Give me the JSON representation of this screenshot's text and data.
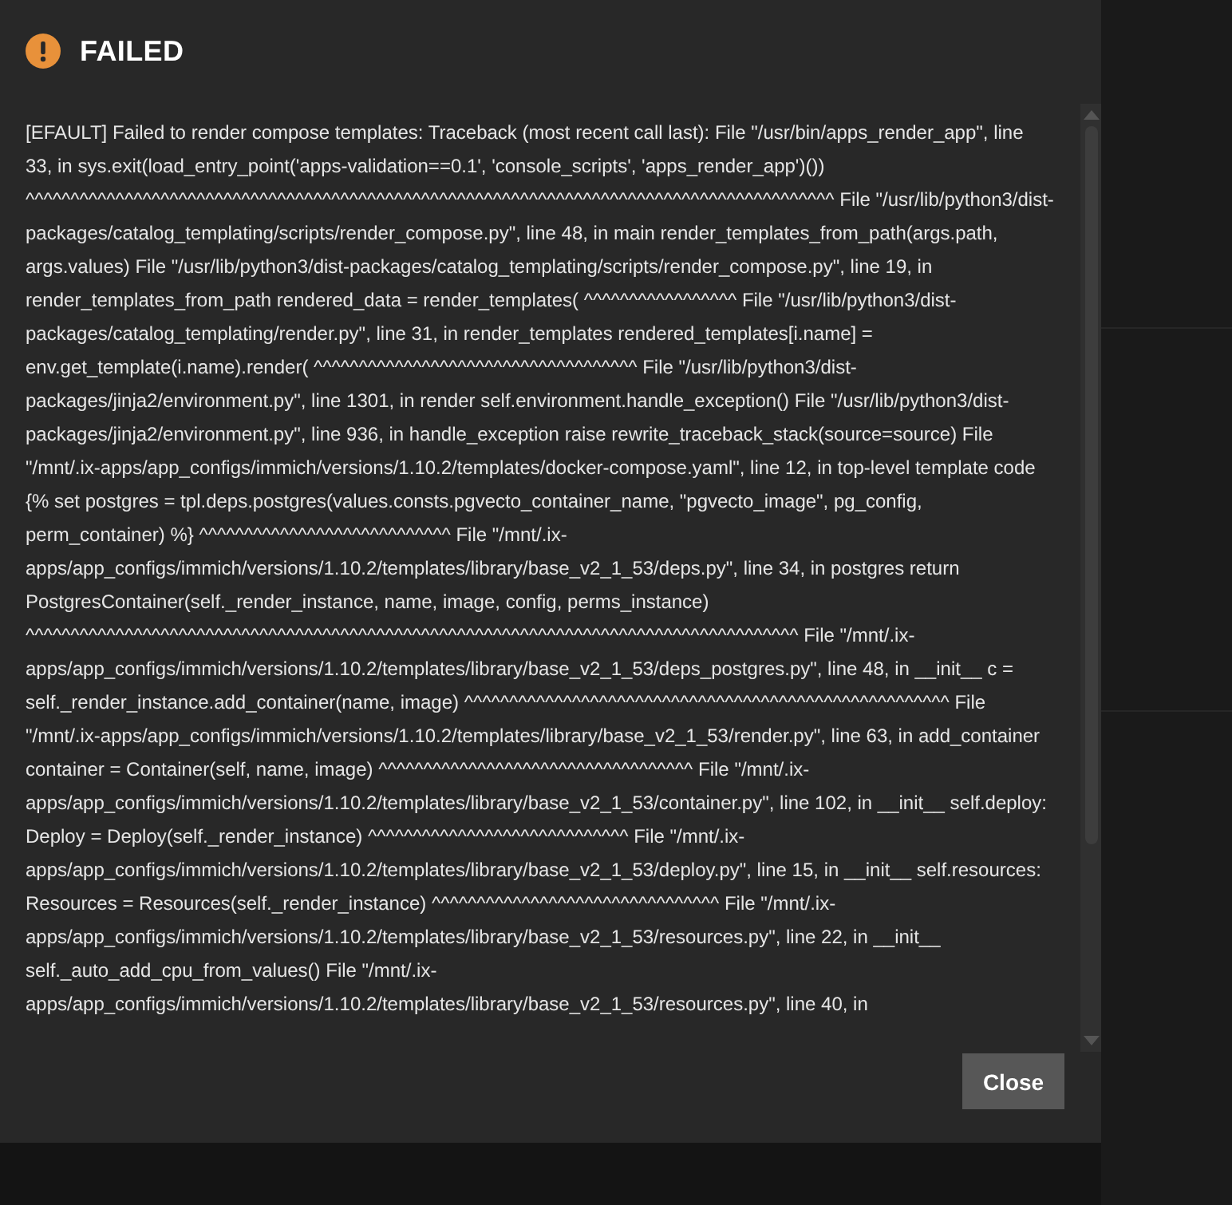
{
  "dialog": {
    "title": "FAILED",
    "message": "[EFAULT] Failed to render compose templates: Traceback (most recent call last): File \"/usr/bin/apps_render_app\", line 33, in sys.exit(load_entry_point('apps-validation==0.1', 'console_scripts', 'apps_render_app')()) ^^^^^^^^^^^^^^^^^^^^^^^^^^^^^^^^^^^^^^^^^^^^^^^^^^^^^^^^^^^^^^^^^^^^^^^^^^^^^^^^^^^^^^^^^^ File \"/usr/lib/python3/dist-packages/catalog_templating/scripts/render_compose.py\", line 48, in main render_templates_from_path(args.path, args.values) File \"/usr/lib/python3/dist-packages/catalog_templating/scripts/render_compose.py\", line 19, in render_templates_from_path rendered_data = render_templates( ^^^^^^^^^^^^^^^^^ File \"/usr/lib/python3/dist-packages/catalog_templating/render.py\", line 31, in render_templates rendered_templates[i.name] = env.get_template(i.name).render( ^^^^^^^^^^^^^^^^^^^^^^^^^^^^^^^^^^^^ File \"/usr/lib/python3/dist-packages/jinja2/environment.py\", line 1301, in render self.environment.handle_exception() File \"/usr/lib/python3/dist-packages/jinja2/environment.py\", line 936, in handle_exception raise rewrite_traceback_stack(source=source) File \"/mnt/.ix-apps/app_configs/immich/versions/1.10.2/templates/docker-compose.yaml\", line 12, in top-level template code {% set postgres = tpl.deps.postgres(values.consts.pgvecto_container_name, \"pgvecto_image\", pg_config, perm_container) %} ^^^^^^^^^^^^^^^^^^^^^^^^^^^^ File \"/mnt/.ix-apps/app_configs/immich/versions/1.10.2/templates/library/base_v2_1_53/deps.py\", line 34, in postgres return PostgresContainer(self._render_instance, name, image, config, perms_instance) ^^^^^^^^^^^^^^^^^^^^^^^^^^^^^^^^^^^^^^^^^^^^^^^^^^^^^^^^^^^^^^^^^^^^^^^^^^^^^^^^^^^^^^ File \"/mnt/.ix-apps/app_configs/immich/versions/1.10.2/templates/library/base_v2_1_53/deps_postgres.py\", line 48, in __init__ c = self._render_instance.add_container(name, image) ^^^^^^^^^^^^^^^^^^^^^^^^^^^^^^^^^^^^^^^^^^^^^^^^^^^^^^ File \"/mnt/.ix-apps/app_configs/immich/versions/1.10.2/templates/library/base_v2_1_53/render.py\", line 63, in add_container container = Container(self, name, image) ^^^^^^^^^^^^^^^^^^^^^^^^^^^^^^^^^^^ File \"/mnt/.ix-apps/app_configs/immich/versions/1.10.2/templates/library/base_v2_1_53/container.py\", line 102, in __init__ self.deploy: Deploy = Deploy(self._render_instance) ^^^^^^^^^^^^^^^^^^^^^^^^^^^^^ File \"/mnt/.ix-apps/app_configs/immich/versions/1.10.2/templates/library/base_v2_1_53/deploy.py\", line 15, in __init__ self.resources: Resources = Resources(self._render_instance) ^^^^^^^^^^^^^^^^^^^^^^^^^^^^^^^^ File \"/mnt/.ix-apps/app_configs/immich/versions/1.10.2/templates/library/base_v2_1_53/resources.py\", line 22, in __init__ self._auto_add_cpu_from_values() File \"/mnt/.ix-apps/app_configs/immich/versions/1.10.2/templates/library/base_v2_1_53/resources.py\", line 40, in",
    "buttons": [
      {
        "label": "Close"
      }
    ]
  }
}
